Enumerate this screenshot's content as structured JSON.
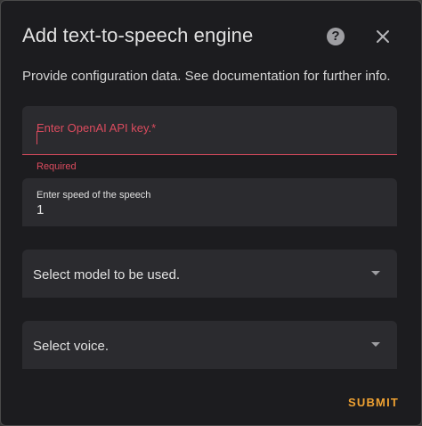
{
  "dialog": {
    "title": "Add text-to-speech engine",
    "help_icon": "help-icon",
    "close_icon": "close-icon",
    "description": "Provide configuration data. See documentation for further info."
  },
  "fields": {
    "api_key": {
      "label": "Enter OpenAI API key.*",
      "value": "",
      "error": "Required"
    },
    "speed": {
      "label": "Enter speed of the speech",
      "value": "1"
    },
    "model": {
      "placeholder": "Select model to be used."
    },
    "voice": {
      "placeholder": "Select voice."
    }
  },
  "actions": {
    "submit_label": "SUBMIT"
  },
  "colors": {
    "background": "#1c1c1f",
    "field_background": "#2b2b2f",
    "error": "#db4b5e",
    "accent": "#f0a232"
  }
}
